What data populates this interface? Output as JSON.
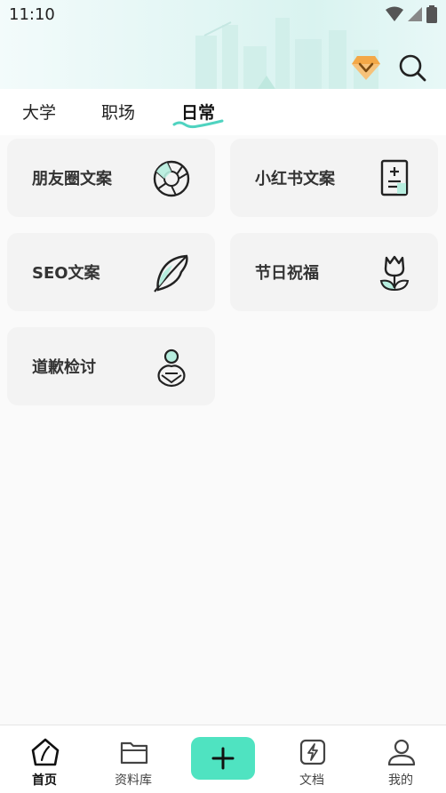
{
  "status_bar": {
    "time": "11:10"
  },
  "tabs": [
    {
      "label": "大学",
      "active": false
    },
    {
      "label": "职场",
      "active": false
    },
    {
      "label": "日常",
      "active": true
    }
  ],
  "cards": [
    {
      "label": "朋友圈文案",
      "icon": "camera-aperture-icon"
    },
    {
      "label": "小红书文案",
      "icon": "document-plus-icon"
    },
    {
      "label": "SEO文案",
      "icon": "feather-icon"
    },
    {
      "label": "节日祝福",
      "icon": "tulip-icon"
    },
    {
      "label": "道歉检讨",
      "icon": "person-apology-icon"
    }
  ],
  "bottom_nav": [
    {
      "label": "首页",
      "icon": "home-pen-icon",
      "active": true
    },
    {
      "label": "资料库",
      "icon": "folder-icon",
      "active": false
    },
    {
      "label": "",
      "icon": "plus-icon",
      "active": false
    },
    {
      "label": "文档",
      "icon": "lightning-doc-icon",
      "active": false
    },
    {
      "label": "我的",
      "icon": "user-icon",
      "active": false
    }
  ],
  "colors": {
    "accent": "#4fe3c1",
    "header_bg": "#dff5f3",
    "card_bg": "#f3f3f3",
    "vip": "#f0a64a"
  }
}
